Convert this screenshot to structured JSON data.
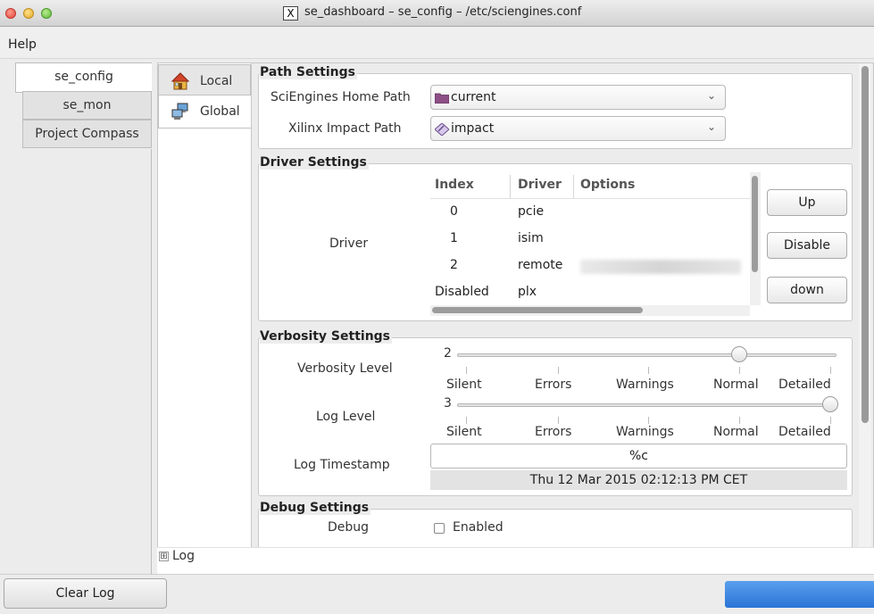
{
  "window": {
    "title": "se_dashboard – se_config – /etc/sciengines.conf",
    "title_icon": "X"
  },
  "menu": {
    "help": "Help"
  },
  "left_tabs": [
    {
      "label": "se_config",
      "active": true
    },
    {
      "label": "se_mon",
      "active": false
    },
    {
      "label": "Project Compass",
      "active": false
    }
  ],
  "vertical_tabs": [
    {
      "label": "Local",
      "icon": "house-icon",
      "active": false
    },
    {
      "label": "Global",
      "icon": "network-computers-icon",
      "active": true
    }
  ],
  "path_settings": {
    "title": "Path Settings",
    "home_label": "SciEngines Home Path",
    "home_value": "current",
    "xilinx_label": "Xilinx Impact Path",
    "xilinx_value": "impact"
  },
  "driver_settings": {
    "title": "Driver Settings",
    "row_label": "Driver",
    "columns": [
      "Index",
      "Driver",
      "Options"
    ],
    "rows": [
      {
        "index": "0",
        "driver": "pcie"
      },
      {
        "index": "1",
        "driver": "isim"
      },
      {
        "index": "2",
        "driver": "remote"
      },
      {
        "index": "Disabled",
        "driver": "plx"
      }
    ],
    "buttons": {
      "up": "Up",
      "disable": "Disable",
      "down": "down"
    }
  },
  "verbosity_settings": {
    "title": "Verbosity Settings",
    "verbosity_label": "Verbosity Level",
    "verbosity_value": "2",
    "log_label": "Log Level",
    "log_value": "3",
    "levels": [
      "Silent",
      "Errors",
      "Warnings",
      "Normal",
      "Detailed"
    ],
    "timestamp_label": "Log Timestamp",
    "timestamp_format": "%c",
    "timestamp_preview": "Thu 12 Mar 2015 02:12:13 PM CET"
  },
  "debug_settings": {
    "title": "Debug Settings",
    "label": "Debug",
    "checkbox_label": "Enabled",
    "checked": false
  },
  "log": {
    "label": "Log",
    "expander": "⊞"
  },
  "bottom": {
    "clear_log": "Clear Log"
  },
  "colors": {
    "progress": "#2a74d6",
    "window_bg": "#ececec"
  }
}
